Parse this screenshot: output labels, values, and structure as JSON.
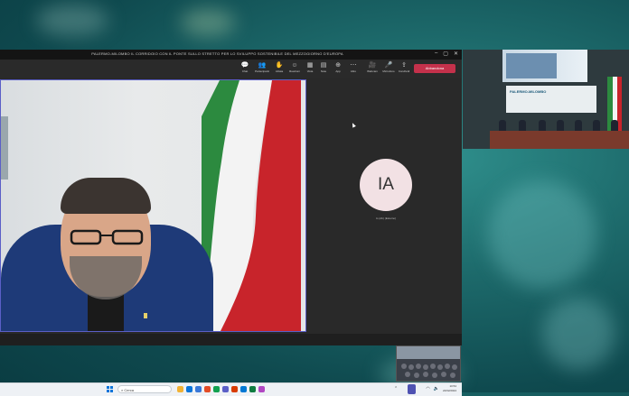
{
  "window": {
    "title": "PALERMO-MILOMBO IL CORRIDOIO CON IL PONTE SULLO STRETTO PER LO SVILUPPO SOSTENIBILE DEL MEZZOGIORNO D'EUROPA",
    "controls": [
      "–",
      "▢",
      "✕"
    ]
  },
  "toolbar": {
    "buttons": [
      {
        "icon": "chat-icon",
        "glyph": "💬",
        "label": "Chat"
      },
      {
        "icon": "people-icon",
        "glyph": "👥",
        "label": "Partecipanti"
      },
      {
        "icon": "raise-hand-icon",
        "glyph": "✋",
        "label": "Alzata"
      },
      {
        "icon": "reactions-icon",
        "glyph": "☺",
        "label": "Reazioni"
      },
      {
        "icon": "view-icon",
        "glyph": "▦",
        "label": "Vista"
      },
      {
        "icon": "notes-icon",
        "glyph": "▤",
        "label": "Note"
      },
      {
        "icon": "apps-icon",
        "glyph": "⊕",
        "label": "App"
      },
      {
        "icon": "more-icon",
        "glyph": "⋯",
        "label": "Altro"
      },
      {
        "icon": "camera-icon",
        "glyph": "🎥",
        "label": "Webcam"
      },
      {
        "icon": "mic-icon",
        "glyph": "🎤",
        "label": "Microfono"
      },
      {
        "icon": "share-icon",
        "glyph": "⇪",
        "label": "Condividi"
      }
    ],
    "leave_label": "Abbandona"
  },
  "participant": {
    "initials": "IA",
    "name": "Io (Ab) (Esterno)"
  },
  "taskbar": {
    "search_label": "Cerca",
    "time": "10:54",
    "date": "22/02/2024",
    "app_colors": [
      "#f2b233",
      "#0a74da",
      "#3a78d8",
      "#e34c26",
      "#12a150",
      "#5b5fc7",
      "#d83b01",
      "#0078d4",
      "#107c41",
      "#b146c2"
    ]
  },
  "room": {
    "banner_text": "PALERMO-MILOMBO"
  },
  "colors": {
    "accent": "#5b5fc7",
    "leave": "#c4314b",
    "flag_green": "#2c8a3f",
    "flag_white": "#f3f3f3",
    "flag_red": "#c8242b"
  }
}
